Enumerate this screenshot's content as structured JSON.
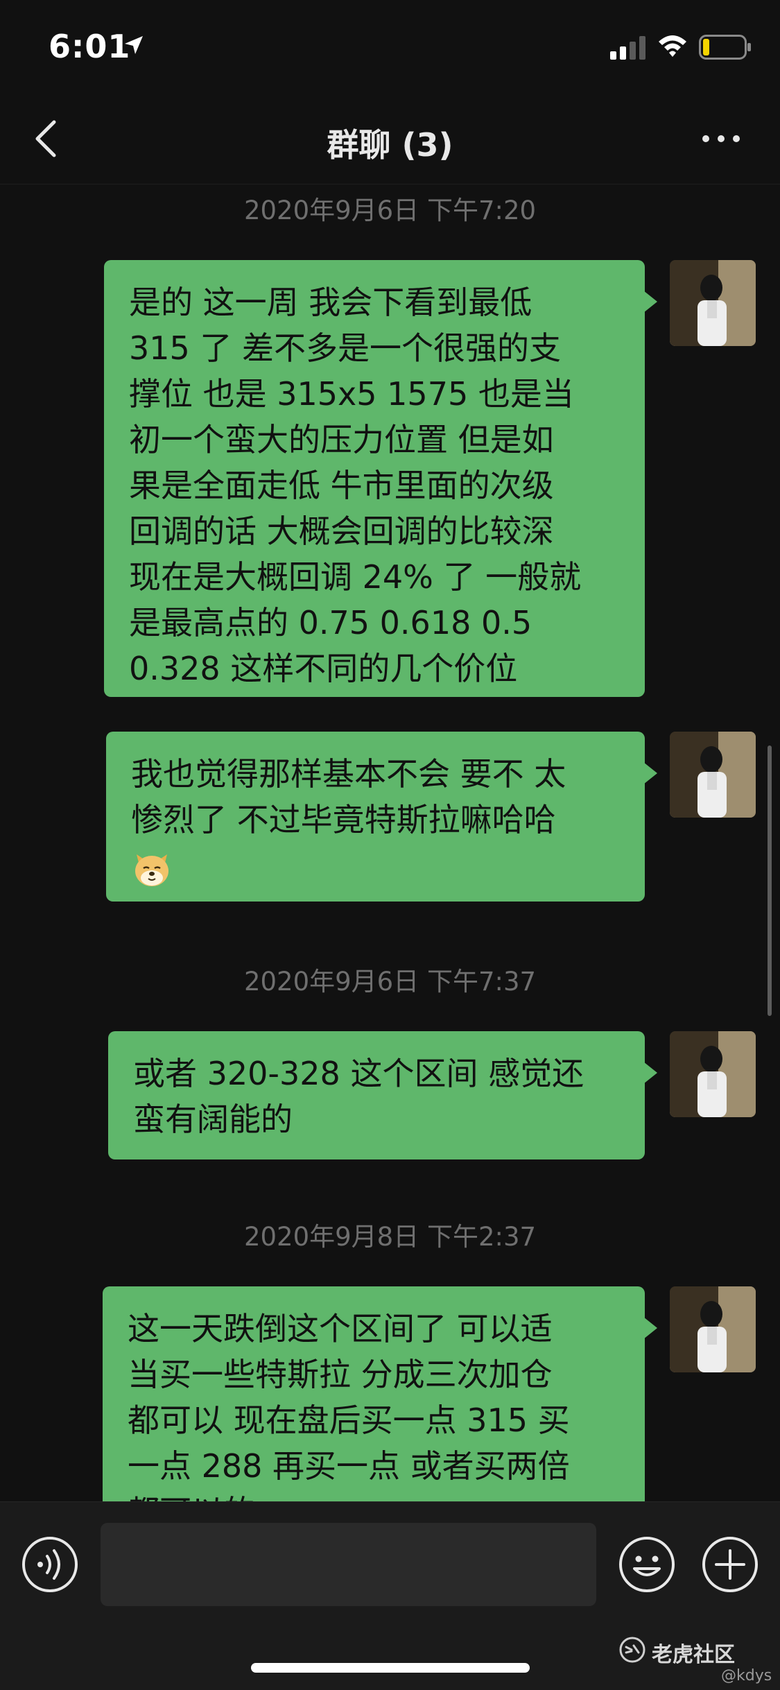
{
  "status_bar": {
    "time": "6:01"
  },
  "nav": {
    "title": "群聊 (3)"
  },
  "messages": [
    {
      "timestamp": "2020年9月6日 下午7:20",
      "lines": [
        "是的 这一周 我会下看到最低",
        "315 了 差不多是一个很强的支",
        "撑位 也是 315x5 1575  也是当",
        "初一个蛮大的压力位置 但是如",
        "果是全面走低 牛市里面的次级",
        "回调的话 大概会回调的比较深",
        "现在是大概回调 24% 了 一般就",
        "是最高点的 0.75 0.618 0.5",
        "0.328 这样不同的几个价位"
      ]
    },
    {
      "lines": [
        "我也觉得那样基本不会 要不 太",
        "惨烈了 不过毕竟特斯拉嘛哈哈"
      ]
    },
    {
      "timestamp": "2020年9月6日 下午7:37",
      "lines": [
        "或者 320-328 这个区间 感觉还",
        "蛮有阔能的"
      ]
    },
    {
      "timestamp": "2020年9月8日 下午2:37",
      "lines": [
        "这一天跌倒这个区间了 可以适",
        "当买一些特斯拉 分成三次加仓",
        "都可以 现在盘后买一点  315 买",
        "一点  288 再买一点 或者买两倍",
        "都可以的"
      ]
    }
  ],
  "input": {
    "placeholder": ""
  },
  "watermark": {
    "brand": "老虎社区",
    "handle": "@kdys"
  },
  "colors": {
    "bubble": "#5fb76b",
    "background": "#111111",
    "input_bar": "#1b1b1b"
  },
  "icons": [
    "location-arrow-icon",
    "signal-icon",
    "wifi-icon",
    "battery-icon",
    "back-icon",
    "more-icon",
    "voice-icon",
    "emoji-icon",
    "plus-icon",
    "dog-emoji-icon",
    "tiger-logo-icon"
  ]
}
